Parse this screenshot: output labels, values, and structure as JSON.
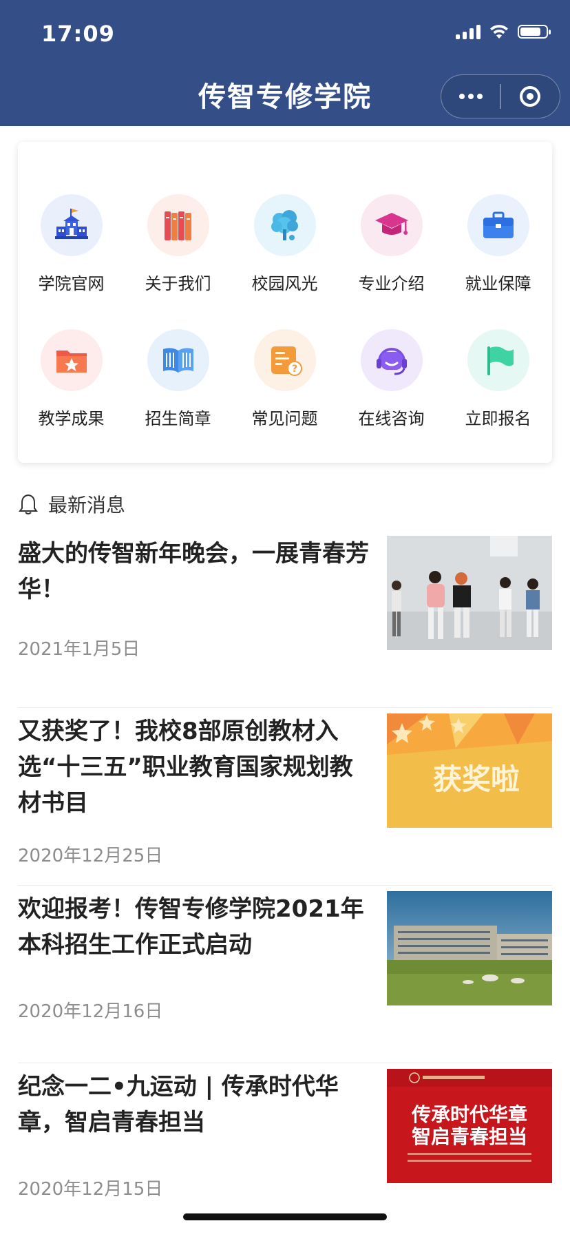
{
  "status_bar": {
    "time": "17:09"
  },
  "header": {
    "title": "传智专修学院"
  },
  "menu": {
    "items": [
      {
        "label": "学院官网",
        "icon": "school-building-icon",
        "bg": "#e9effb"
      },
      {
        "label": "关于我们",
        "icon": "books-icon",
        "bg": "#fdeee9"
      },
      {
        "label": "校园风光",
        "icon": "tree-icon",
        "bg": "#e5f5fb"
      },
      {
        "label": "专业介绍",
        "icon": "graduation-cap-icon",
        "bg": "#fbe9f1"
      },
      {
        "label": "就业保障",
        "icon": "briefcase-icon",
        "bg": "#e9f1fc"
      },
      {
        "label": "教学成果",
        "icon": "star-folder-icon",
        "bg": "#fdeceb"
      },
      {
        "label": "招生简章",
        "icon": "open-book-icon",
        "bg": "#e7f1fb"
      },
      {
        "label": "常见问题",
        "icon": "faq-note-icon",
        "bg": "#fdf1e5"
      },
      {
        "label": "在线咨询",
        "icon": "headset-icon",
        "bg": "#efe9fb"
      },
      {
        "label": "立即报名",
        "icon": "flag-icon",
        "bg": "#e6f8f3"
      }
    ]
  },
  "news": {
    "header_label": "最新消息",
    "items": [
      {
        "title": "盛大的传智新年晚会，一展青春芳华！",
        "date": "2021年1月5日",
        "thumb": "dance-party-photo"
      },
      {
        "title": "又获奖了！我校8部原创教材入选“十三五”职业教育国家规划教材书目",
        "date": "2020年12月25日",
        "thumb": "award-banner",
        "thumb_text": "获奖啦"
      },
      {
        "title": "欢迎报考！传智专修学院2021年本科招生工作正式启动",
        "date": "2020年12月16日",
        "thumb": "campus-photo"
      },
      {
        "title": "纪念一二•九运动 | 传承时代华章，智启青春担当",
        "date": "2020年12月15日",
        "thumb": "red-poster",
        "thumb_text_1": "传承时代华章",
        "thumb_text_2": "智启青春担当"
      }
    ]
  }
}
